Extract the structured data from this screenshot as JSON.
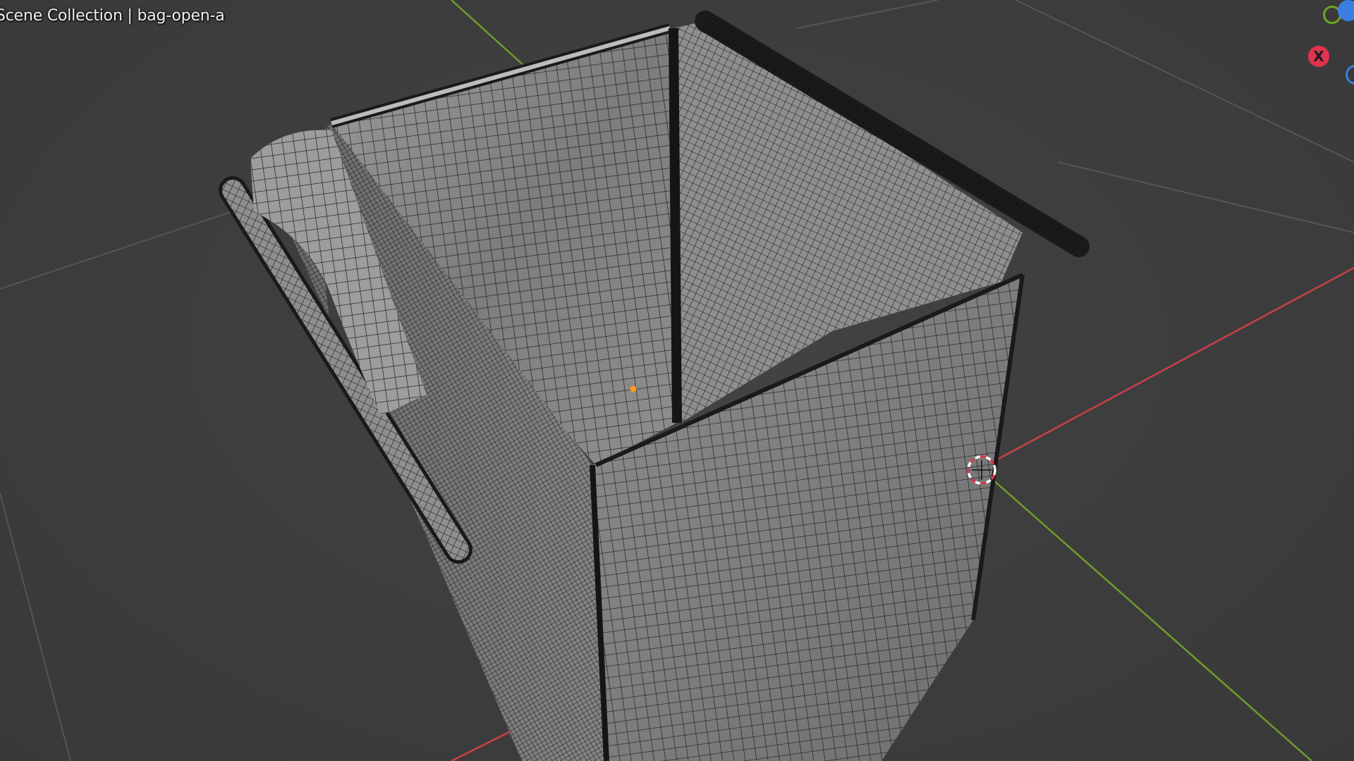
{
  "viewport": {
    "overlay_text": "Scene Collection | bag-open-a",
    "overlay_prev_line": "",
    "background_color": "#3c3c3c",
    "grid_color": "#555555",
    "x_axis_color": "#c8404a",
    "y_axis_color": "#6f9c2a"
  },
  "gizmo": {
    "x_label": "X",
    "x_color": "#e0334f",
    "y_color": "#6ba526",
    "z_color": "#3a7fe0"
  },
  "object": {
    "name": "bag-open-a",
    "display": "wireframe-over-solid",
    "mesh_color": "#8a8a8a",
    "wire_color": "#141414",
    "origin_color": "#ff9a1a"
  },
  "cursor": {
    "name": "3d-cursor",
    "ring_colors": [
      "#ffffff",
      "#e0334f"
    ]
  }
}
